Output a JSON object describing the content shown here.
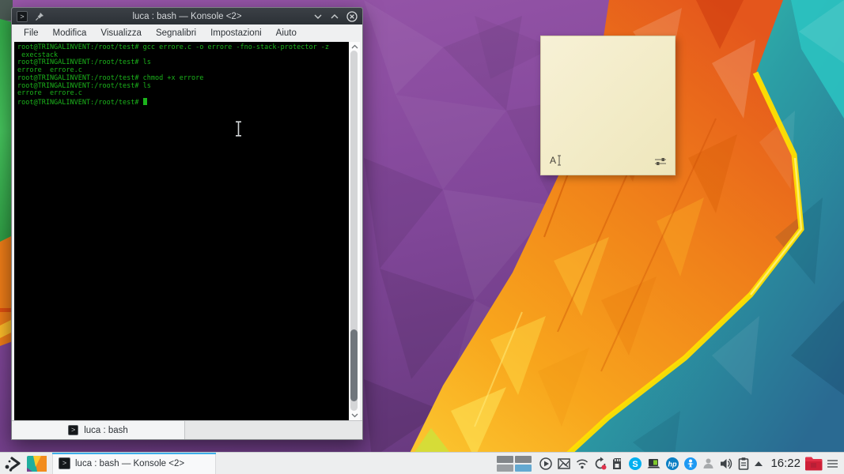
{
  "colors": {
    "accent_blue": "#3daee9",
    "terminal_green": "#1bb31b",
    "titlebar_bg": "#2f343a",
    "chrome_bg": "#eff0f1",
    "note_bg": "#f2ebc6",
    "skype_blue": "#00aff0",
    "hp_blue": "#0b7fc4",
    "info_blue": "#1d99f3",
    "folder_red": "#e23048",
    "wallpaper_purple": "#7d4492",
    "wallpaper_orange": "#f0831b",
    "wallpaper_teal": "#2bb3a0"
  },
  "konsole": {
    "title": "luca : bash — Konsole <2>",
    "menu": [
      "File",
      "Modifica",
      "Visualizza",
      "Segnalibri",
      "Impostazioni",
      "Aiuto"
    ],
    "terminal_lines": [
      "root@TRINGALINVENT:/root/test# gcc errore.c -o errore -fno-stack-protector -z",
      " execstack",
      "root@TRINGALINVENT:/root/test# ls",
      "errore  errore.c",
      "root@TRINGALINVENT:/root/test# chmod +x errore",
      "root@TRINGALINVENT:/root/test# ls",
      "errore  errore.c",
      "root@TRINGALINVENT:/root/test# "
    ],
    "tab_label": "luca : bash",
    "window_buttons": [
      "minimize",
      "maximize",
      "close"
    ]
  },
  "sticky_note": {
    "text": "A"
  },
  "taskbar": {
    "task_button_label": "luca : bash — Konsole <2>",
    "clock": "16:22",
    "tray_icon_names": [
      "virtual-desktop-pager",
      "media-player-icon",
      "image-frame-icon",
      "wifi-icon",
      "updates-icon",
      "device-notifier-icon",
      "skype-icon",
      "battery-icon",
      "hp-printer-icon",
      "info-icon",
      "user-switch-icon",
      "volume-icon",
      "clipboard-icon",
      "expand-tray-icon",
      "red-folder-icon",
      "panel-menu-icon"
    ]
  }
}
